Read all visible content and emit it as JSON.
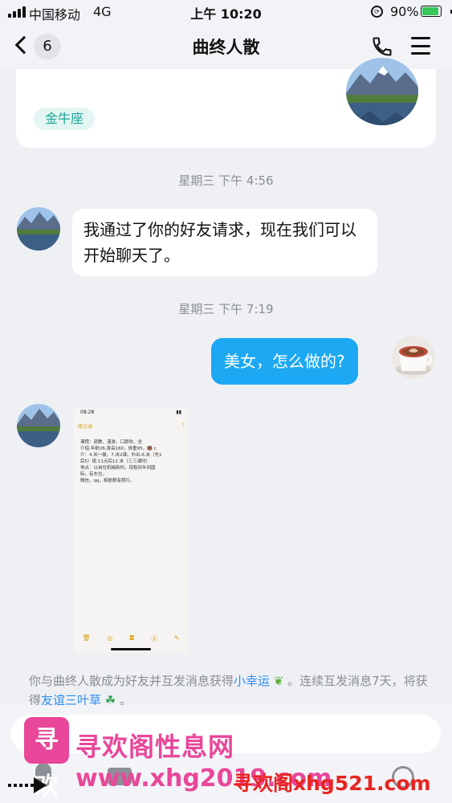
{
  "status_bar": {
    "carrier": "中国移动",
    "network": "4G",
    "time": "上午 10:20",
    "battery": "90%"
  },
  "nav": {
    "back_badge": "6",
    "title": "曲终人散"
  },
  "profile_card": {
    "zodiac_tag": "金牛座"
  },
  "messages": {
    "ts1": "星期三 下午 4:56",
    "msg1": "我通过了你的好友请求，现在我们可以开始聊天了。",
    "ts2": "星期三 下午 7:19",
    "msg2": "美女，怎么做的?",
    "shot": {
      "status_time": "08:28",
      "back_label": "备忘录",
      "lines": [
        "课程：调教、漫游、口舔吹、全",
        "介绍:年龄26,身高160，体重95，🐻 c",
        "介：4.米一碟，7.米2课。外出:6.米（先1",
        "后5）夜:11点后12.米（三三课时）",
        "地点：以自住机械新村。现租到半间国",
        "际，有车位。",
        "微信，qq，相册薪有照片。"
      ]
    }
  },
  "system_tip": {
    "prefix": "你与曲终人散成为好友并互发消息获得",
    "link1": "小幸运",
    "mid": "。连续互发消息7天，将获得",
    "link2": "友谊三叶草",
    "suffix": "。"
  },
  "watermark": {
    "logo_text": "寻欢",
    "title": "寻欢阁性息网",
    "url1": "www.xhg2019.com",
    "url2": "寻欢阁xhg521.com"
  },
  "colors": {
    "outgoing_bubble": "#1ca8f3",
    "link": "#2f8ef0",
    "zodiac_tag_text": "#1aa79a",
    "watermark": "#e8479a"
  }
}
